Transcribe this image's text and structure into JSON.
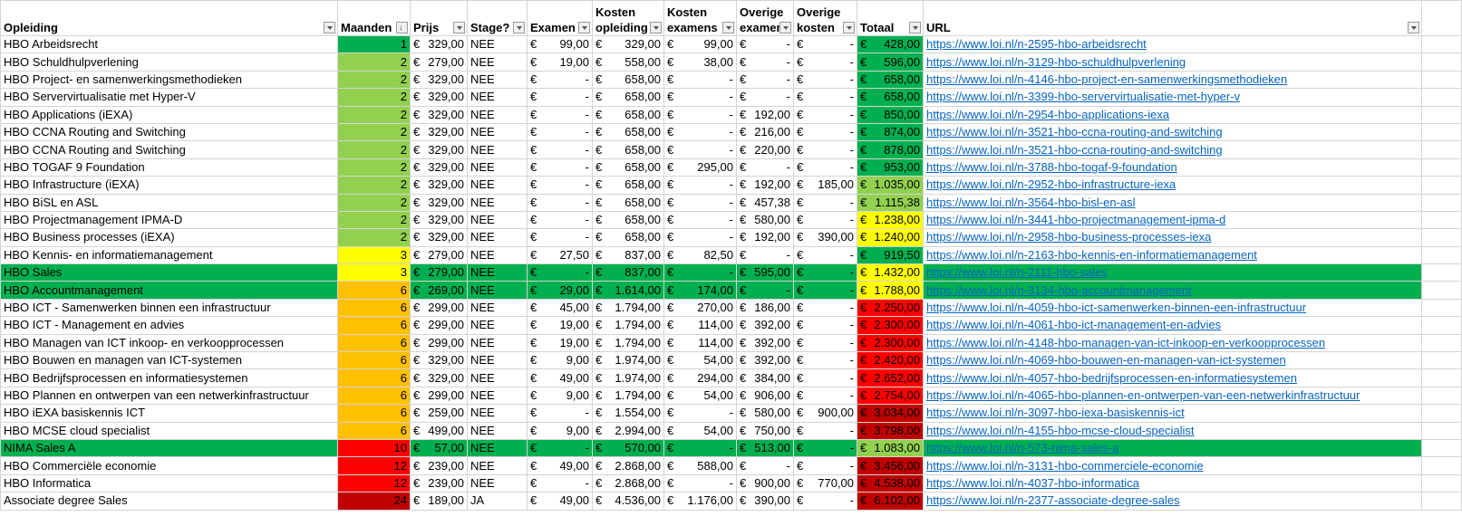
{
  "headers": [
    "Opleiding",
    "Maanden",
    "Prijs",
    "Stage?",
    "Examen",
    "Kosten opleiding",
    "Kosten examens",
    "Overige examen",
    "Overige kosten",
    "Totaal",
    "URL"
  ],
  "colors": {
    "dark_green": "#00b050",
    "light_green": "#92d050",
    "yellow": "#ffff00",
    "orange": "#ffc000",
    "red": "#ff0000",
    "dark_red": "#c00000"
  },
  "rows": [
    [
      "HBO Arbeidsrecht",
      "1",
      "329,00",
      "NEE",
      "99,00",
      "329,00",
      "99,00",
      "-",
      "-",
      "428,00",
      "https://www.loi.nl/n-2595-hbo-arbeidsrecht",
      "dark_green",
      "dark_green",
      false
    ],
    [
      "HBO Schuldhulpverlening",
      "2",
      "279,00",
      "NEE",
      "19,00",
      "558,00",
      "38,00",
      "-",
      "-",
      "596,00",
      "https://www.loi.nl/n-3129-hbo-schuldhulpverlening",
      "light_green",
      "dark_green",
      false
    ],
    [
      "HBO Project- en samenwerkingsmethodieken",
      "2",
      "329,00",
      "NEE",
      "-",
      "658,00",
      "-",
      "-",
      "-",
      "658,00",
      "https://www.loi.nl/n-4146-hbo-project-en-samenwerkingsmethodieken",
      "light_green",
      "dark_green",
      false
    ],
    [
      "HBO Servervirtualisatie met Hyper-V",
      "2",
      "329,00",
      "NEE",
      "-",
      "658,00",
      "-",
      "-",
      "-",
      "658,00",
      "https://www.loi.nl/n-3399-hbo-servervirtualisatie-met-hyper-v",
      "light_green",
      "dark_green",
      false
    ],
    [
      "HBO Applications (iEXA)",
      "2",
      "329,00",
      "NEE",
      "-",
      "658,00",
      "-",
      "192,00",
      "-",
      "850,00",
      "https://www.loi.nl/n-2954-hbo-applications-iexa",
      "light_green",
      "dark_green",
      false
    ],
    [
      "HBO CCNA Routing and Switching",
      "2",
      "329,00",
      "NEE",
      "-",
      "658,00",
      "-",
      "216,00",
      "-",
      "874,00",
      "https://www.loi.nl/n-3521-hbo-ccna-routing-and-switching",
      "light_green",
      "dark_green",
      false
    ],
    [
      "HBO CCNA Routing and Switching",
      "2",
      "329,00",
      "NEE",
      "-",
      "658,00",
      "-",
      "220,00",
      "-",
      "878,00",
      "https://www.loi.nl/n-3521-hbo-ccna-routing-and-switching",
      "light_green",
      "dark_green",
      false
    ],
    [
      "HBO TOGAF 9 Foundation",
      "2",
      "329,00",
      "NEE",
      "-",
      "658,00",
      "295,00",
      "-",
      "-",
      "953,00",
      "https://www.loi.nl/n-3788-hbo-togaf-9-foundation",
      "light_green",
      "dark_green",
      false
    ],
    [
      "HBO Infrastructure (iEXA)",
      "2",
      "329,00",
      "NEE",
      "-",
      "658,00",
      "-",
      "192,00",
      "185,00",
      "1.035,00",
      "https://www.loi.nl/n-2952-hbo-infrastructure-iexa",
      "light_green",
      "light_green",
      false
    ],
    [
      "HBO BiSL en ASL",
      "2",
      "329,00",
      "NEE",
      "-",
      "658,00",
      "-",
      "457,38",
      "-",
      "1.115,38",
      "https://www.loi.nl/n-3564-hbo-bisl-en-asl",
      "light_green",
      "light_green",
      false
    ],
    [
      "HBO Projectmanagement IPMA-D",
      "2",
      "329,00",
      "NEE",
      "-",
      "658,00",
      "-",
      "580,00",
      "-",
      "1.238,00",
      "https://www.loi.nl/n-3441-hbo-projectmanagement-ipma-d",
      "light_green",
      "yellow",
      false
    ],
    [
      "HBO Business processes (iEXA)",
      "2",
      "329,00",
      "NEE",
      "-",
      "658,00",
      "-",
      "192,00",
      "390,00",
      "1.240,00",
      "https://www.loi.nl/n-2958-hbo-business-processes-iexa",
      "light_green",
      "yellow",
      false
    ],
    [
      "HBO Kennis- en informatiemanagement",
      "3",
      "279,00",
      "NEE",
      "27,50",
      "837,00",
      "82,50",
      "-",
      "-",
      "919,50",
      "https://www.loi.nl/n-2163-hbo-kennis-en-informatiemanagement",
      "yellow",
      "dark_green",
      false
    ],
    [
      "HBO Sales",
      "3",
      "279,00",
      "NEE",
      "-",
      "837,00",
      "-",
      "595,00",
      "-",
      "1.432,00",
      "https://www.loi.nl/n-2111-hbo-sales",
      "yellow",
      "yellow",
      true
    ],
    [
      "HBO Accountmanagement",
      "6",
      "269,00",
      "NEE",
      "29,00",
      "1.614,00",
      "174,00",
      "-",
      "-",
      "1.788,00",
      "https://www.loi.nl/n-3134-hbo-accountmanagement",
      "orange",
      "yellow",
      true
    ],
    [
      "HBO ICT - Samenwerken binnen een infrastructuur",
      "6",
      "299,00",
      "NEE",
      "45,00",
      "1.794,00",
      "270,00",
      "186,00",
      "-",
      "2.250,00",
      "https://www.loi.nl/n-4059-hbo-ict-samenwerken-binnen-een-infrastructuur",
      "orange",
      "red",
      false
    ],
    [
      "HBO ICT - Management en advies",
      "6",
      "299,00",
      "NEE",
      "19,00",
      "1.794,00",
      "114,00",
      "392,00",
      "-",
      "2.300,00",
      "https://www.loi.nl/n-4061-hbo-ict-management-en-advies",
      "orange",
      "red",
      false
    ],
    [
      "HBO Managen van ICT inkoop- en verkoopprocessen",
      "6",
      "299,00",
      "NEE",
      "19,00",
      "1.794,00",
      "114,00",
      "392,00",
      "-",
      "2.300,00",
      "https://www.loi.nl/n-4148-hbo-managen-van-ict-inkoop-en-verkoopprocessen",
      "orange",
      "red",
      false
    ],
    [
      "HBO Bouwen en managen van ICT-systemen",
      "6",
      "329,00",
      "NEE",
      "9,00",
      "1.974,00",
      "54,00",
      "392,00",
      "-",
      "2.420,00",
      "https://www.loi.nl/n-4069-hbo-bouwen-en-managen-van-ict-systemen",
      "orange",
      "red",
      false
    ],
    [
      "HBO Bedrijfsprocessen en informatiesystemen",
      "6",
      "329,00",
      "NEE",
      "49,00",
      "1.974,00",
      "294,00",
      "384,00",
      "-",
      "2.652,00",
      "https://www.loi.nl/n-4057-hbo-bedrijfsprocessen-en-informatiesystemen",
      "orange",
      "red",
      false
    ],
    [
      "HBO Plannen en ontwerpen van een netwerkinfrastructuur",
      "6",
      "299,00",
      "NEE",
      "9,00",
      "1.794,00",
      "54,00",
      "906,00",
      "-",
      "2.754,00",
      "https://www.loi.nl/n-4065-hbo-plannen-en-ontwerpen-van-een-netwerkinfrastructuur",
      "orange",
      "red",
      false
    ],
    [
      "HBO iEXA basiskennis ICT",
      "6",
      "259,00",
      "NEE",
      "-",
      "1.554,00",
      "-",
      "580,00",
      "900,00",
      "3.034,00",
      "https://www.loi.nl/n-3097-hbo-iexa-basiskennis-ict",
      "orange",
      "dark_red",
      false
    ],
    [
      "HBO MCSE cloud specialist",
      "6",
      "499,00",
      "NEE",
      "9,00",
      "2.994,00",
      "54,00",
      "750,00",
      "-",
      "3.798,00",
      "https://www.loi.nl/n-4155-hbo-mcse-cloud-specialist",
      "orange",
      "dark_red",
      false
    ],
    [
      "NIMA Sales A",
      "10",
      "57,00",
      "NEE",
      "-",
      "570,00",
      "-",
      "513,00",
      "-",
      "1.083,00",
      "https://www.loi.nl/n-573-nima-sales-a",
      "red",
      "light_green",
      true
    ],
    [
      "HBO Commerciële economie",
      "12",
      "239,00",
      "NEE",
      "49,00",
      "2.868,00",
      "588,00",
      "-",
      "-",
      "3.456,00",
      "https://www.loi.nl/n-3131-hbo-commerciele-economie",
      "red",
      "dark_red",
      false
    ],
    [
      "HBO Informatica",
      "12",
      "239,00",
      "NEE",
      "-",
      "2.868,00",
      "-",
      "900,00",
      "770,00",
      "4.538,00",
      "https://www.loi.nl/n-4037-hbo-informatica",
      "red",
      "dark_red",
      false
    ],
    [
      "Associate degree Sales",
      "24",
      "189,00",
      "JA",
      "49,00",
      "4.536,00",
      "1.176,00",
      "390,00",
      "-",
      "6.102,00",
      "https://www.loi.nl/n-2377-associate-degree-sales",
      "dark_red",
      "dark_red",
      false
    ]
  ],
  "currency": "€"
}
